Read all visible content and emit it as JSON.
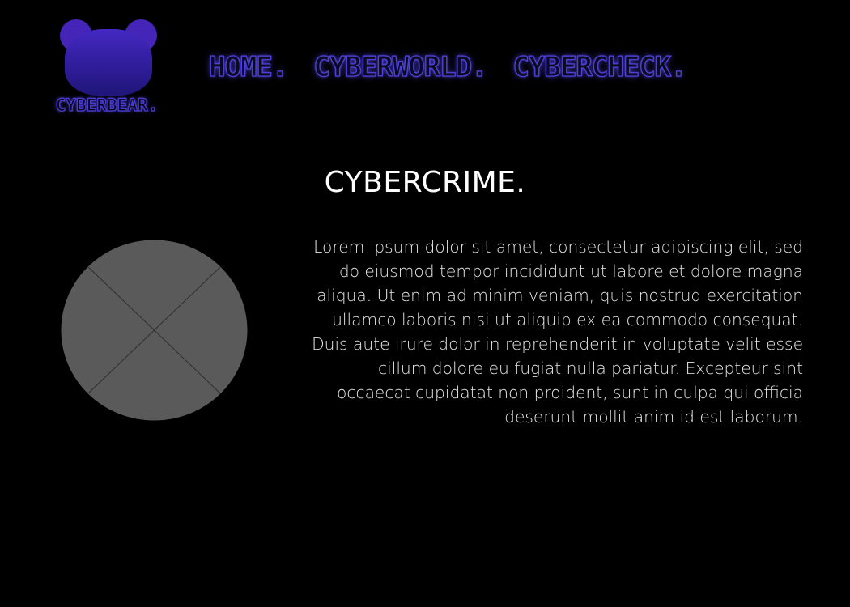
{
  "brand": {
    "name": "CYBERBEAR.",
    "colors": {
      "logo_primary": "#4425b8",
      "nav_outline": "#4d40d8",
      "background": "#000000"
    }
  },
  "nav": {
    "items": [
      {
        "label": "HOME."
      },
      {
        "label": "CYBERWORLD."
      },
      {
        "label": "CYBERCHECK."
      }
    ]
  },
  "main": {
    "title": "CYBERCRIME.",
    "image_icon": "image-placeholder-icon",
    "body": "Lorem ipsum dolor sit amet, consectetur adipiscing elit, sed do eiusmod tempor incididunt ut labore et dolore magna aliqua. Ut enim ad minim veniam, quis nostrud exercitation ullamco laboris nisi ut aliquip ex ea commodo consequat. Duis aute irure dolor in reprehenderit in voluptate velit esse cillum dolore eu fugiat nulla pariatur. Excepteur sint occaecat cupidatat non proident, sunt in culpa qui officia deserunt mollit anim id est laborum."
  }
}
